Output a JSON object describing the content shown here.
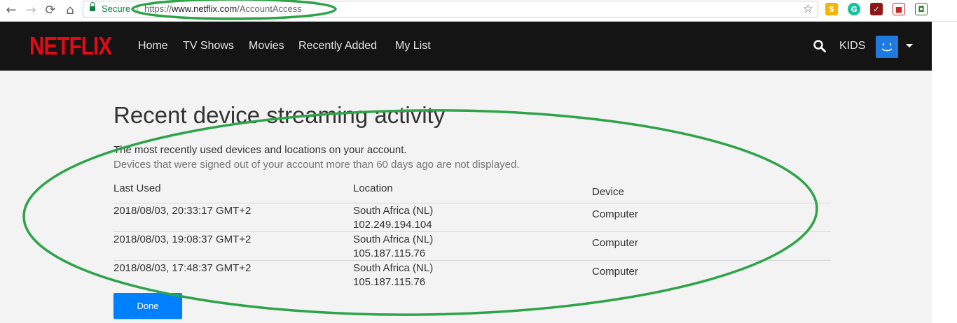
{
  "browser": {
    "back_icon": "←",
    "forward_icon": "→",
    "reload_icon": "⟳",
    "home_icon": "⌂",
    "secure_label": "Secure",
    "url_scheme": "https://",
    "url_host": "www.netflix.com",
    "url_path": "/AccountAccess",
    "bookmark_icon": "☆",
    "extensions": [
      "S",
      "G",
      "✓",
      "■",
      "◘"
    ]
  },
  "header": {
    "logo": "NETFLIX",
    "nav": [
      "Home",
      "TV Shows",
      "Movies",
      "Recently Added",
      "My List"
    ],
    "kids": "KIDS"
  },
  "page": {
    "title": "Recent device streaming activity",
    "subtitle": "The most recently used devices and locations on your account.",
    "note": "Devices that were signed out of your account more than 60 days ago are not displayed.",
    "columns": {
      "last_used": "Last Used",
      "location": "Location",
      "device": "Device"
    },
    "rows": [
      {
        "last_used": "2018/08/03, 20:33:17 GMT+2",
        "location": "South Africa (NL)",
        "ip": "102.249.194.104",
        "device": "Computer"
      },
      {
        "last_used": "2018/08/03, 19:08:37 GMT+2",
        "location": "South Africa (NL)",
        "ip": "105.187.115.76",
        "device": "Computer"
      },
      {
        "last_used": "2018/08/03, 17:48:37 GMT+2",
        "location": "South Africa (NL)",
        "ip": "105.187.115.76",
        "device": "Computer"
      }
    ],
    "done_label": "Done"
  },
  "colors": {
    "netflix_red": "#e50914",
    "header_bg": "#141414",
    "content_bg": "#f3f3f3",
    "button_blue": "#0080ff",
    "annotation_green": "#2ea34a"
  }
}
